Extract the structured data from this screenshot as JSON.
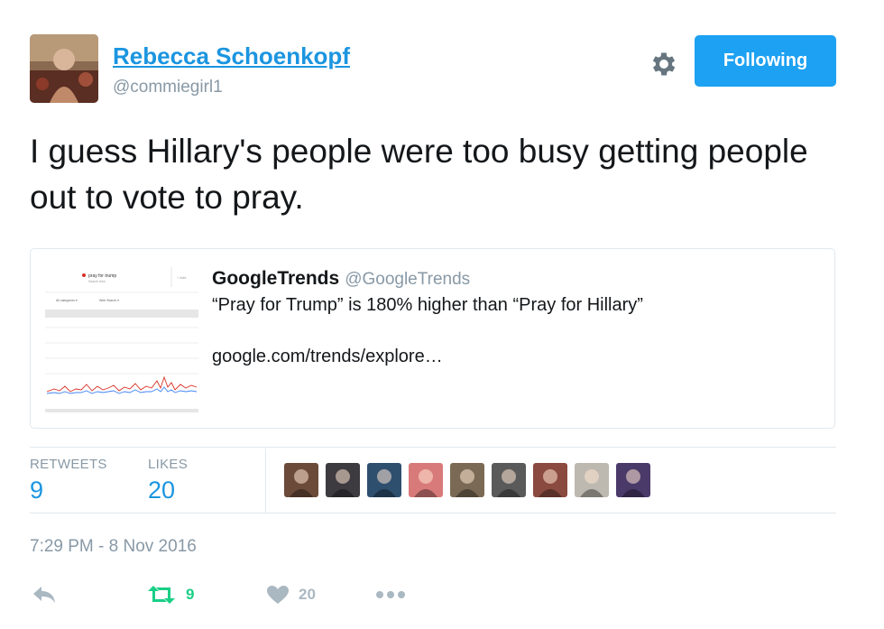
{
  "header": {
    "display_name": "Rebecca Schoenkopf",
    "handle": "@commiegirl1",
    "follow_label": "Following"
  },
  "tweet": {
    "text": "I guess Hillary's people were too busy getting people out to vote to pray."
  },
  "quoted": {
    "name": "GoogleTrends",
    "handle": "@GoogleTrends",
    "text": "“Pray for Trump” is 180% higher than “Pray for Hillary”",
    "link": "google.com/trends/explore…",
    "thumbnail": {
      "search_term": "pray for trump",
      "sub": "Search term",
      "add_label": "+ Add",
      "filter1": "All categories ▾",
      "filter2": "Web Search ▾"
    }
  },
  "stats": {
    "retweets_label": "RETWEETS",
    "retweets_value": "9",
    "likes_label": "LIKES",
    "likes_value": "20",
    "face_colors": [
      "#6b4a3a",
      "#3d3a40",
      "#2f4f6f",
      "#d97a7a",
      "#7a6a55",
      "#5a5a5a",
      "#8a4a40",
      "#bdb8b0",
      "#4a3a6a"
    ]
  },
  "timestamp": "7:29 PM - 8 Nov 2016",
  "actions": {
    "retweet_count": "9",
    "like_count": "20"
  },
  "colors": {
    "link": "#1b95e0",
    "button": "#1da1f2",
    "retweet": "#19cf86",
    "muted": "#8899a6"
  }
}
